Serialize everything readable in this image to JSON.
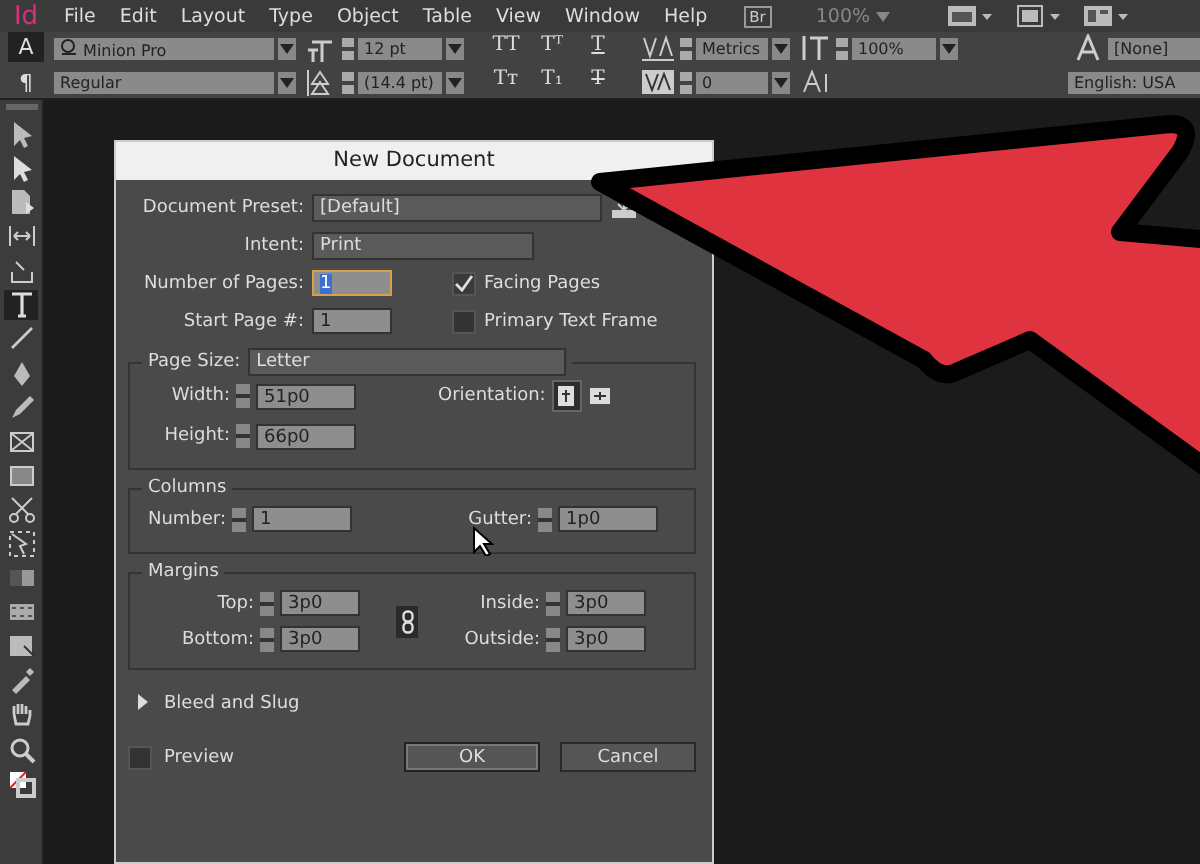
{
  "app_logo": "Id",
  "menu": [
    "File",
    "Edit",
    "Layout",
    "Type",
    "Object",
    "Table",
    "View",
    "Window",
    "Help"
  ],
  "bridge": "Br",
  "zoom": "100%",
  "control_panel": {
    "modes": [
      {
        "glyph": "A",
        "selected": true
      },
      {
        "glyph": "¶",
        "selected": false
      }
    ],
    "font": "Minion Pro",
    "style": "Regular",
    "size": "12 pt",
    "leading": "(14.4 pt)",
    "type_styles": [
      {
        "glyph": "TT",
        "kind": "plain"
      },
      {
        "glyph": "Tᵀ",
        "kind": "plain"
      },
      {
        "glyph": "T",
        "kind": "underline"
      },
      {
        "glyph": "Tт",
        "kind": "plain"
      },
      {
        "glyph": "T₁",
        "kind": "plain"
      },
      {
        "glyph": "T",
        "kind": "strike"
      }
    ],
    "kerning": "Metrics",
    "tracking": "0",
    "vertical_scale": "100%",
    "character_style": "[None]",
    "language": "English: USA"
  },
  "toolbox": [
    {
      "kind": "selection",
      "selected": false
    },
    {
      "kind": "direct",
      "selected": false
    },
    {
      "kind": "page",
      "selected": false
    },
    {
      "kind": "gap",
      "selected": false
    },
    {
      "kind": "collector",
      "selected": false
    },
    {
      "kind": "type",
      "selected": true
    },
    {
      "kind": "line",
      "selected": false
    },
    {
      "kind": "pen",
      "selected": false
    },
    {
      "kind": "pencil",
      "selected": false
    },
    {
      "kind": "frame",
      "selected": false
    },
    {
      "kind": "rect",
      "selected": false
    },
    {
      "kind": "scissors",
      "selected": false
    },
    {
      "kind": "transform",
      "selected": false
    },
    {
      "kind": "gradient",
      "selected": false
    },
    {
      "kind": "feather",
      "selected": false
    },
    {
      "kind": "note",
      "selected": false
    },
    {
      "kind": "eyedropper",
      "selected": false
    },
    {
      "kind": "hand",
      "selected": false
    },
    {
      "kind": "zoom",
      "selected": false
    },
    {
      "kind": "colors",
      "selected": false
    }
  ],
  "dialog": {
    "title": "New Document",
    "preset_label": "Document Preset:",
    "preset": "[Default]",
    "intent_label": "Intent:",
    "intent": "Print",
    "pages_label": "Number of Pages:",
    "pages": "1",
    "start_label": "Start Page #:",
    "start": "1",
    "facing": {
      "label": "Facing Pages",
      "checked": true
    },
    "primary": {
      "label": "Primary Text Frame",
      "checked": false
    },
    "page_size_label": "Page Size:",
    "page_size": "Letter",
    "width_label": "Width:",
    "width": "51p0",
    "height_label": "Height:",
    "height": "66p0",
    "orientation_label": "Orientation:",
    "orientations": [
      {
        "kind": "portrait",
        "selected": true
      },
      {
        "kind": "landscape",
        "selected": false
      }
    ],
    "columns": {
      "title": "Columns",
      "fields": [
        {
          "label": "Number:",
          "value": "1"
        },
        {
          "label": "Gutter:",
          "value": "1p0"
        }
      ]
    },
    "margins": {
      "title": "Margins",
      "fields": [
        {
          "label": "Top:",
          "value": "3p0"
        },
        {
          "label": "Inside:",
          "value": "3p0"
        },
        {
          "label": "Bottom:",
          "value": "3p0"
        },
        {
          "label": "Outside:",
          "value": "3p0"
        }
      ]
    },
    "bleed": {
      "label": "Bleed and Slug",
      "expanded": false
    },
    "preview": {
      "label": "Preview",
      "checked": false
    },
    "buttons": [
      "OK",
      "Cancel"
    ]
  }
}
